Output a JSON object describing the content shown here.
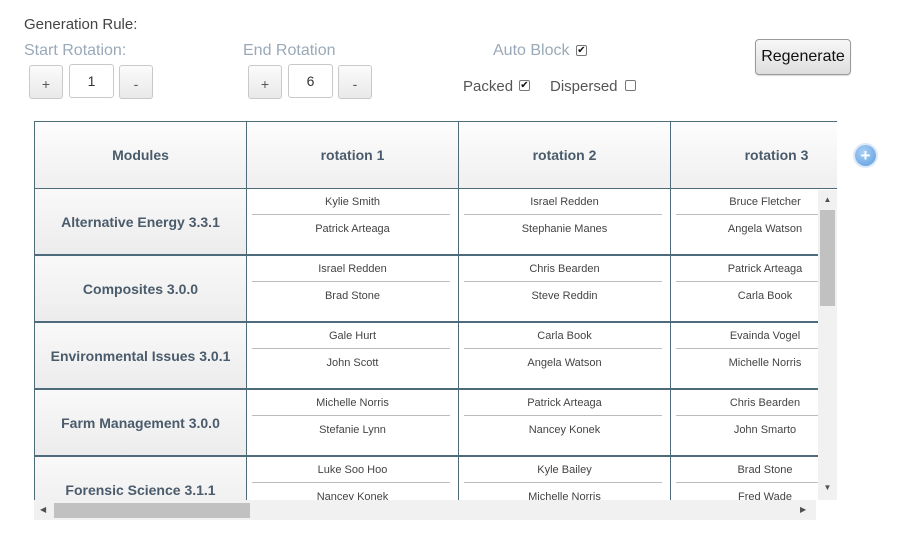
{
  "generation_rule_label": "Generation Rule:",
  "start_rotation": {
    "label": "Start Rotation:",
    "plus": "+",
    "minus": "-",
    "value": "1"
  },
  "end_rotation": {
    "label": "End Rotation",
    "plus": "+",
    "minus": "-",
    "value": "6"
  },
  "options": {
    "auto_block": {
      "label": "Auto Block",
      "checked": true
    },
    "packed": {
      "label": "Packed",
      "checked": true
    },
    "dispersed": {
      "label": "Dispersed",
      "checked": false
    }
  },
  "regenerate_label": "Regenerate",
  "check_glyph": "✔",
  "table": {
    "header": [
      "Modules",
      "rotation 1",
      "rotation 2",
      "rotation 3"
    ],
    "rows": [
      {
        "module": "Alternative Energy 3.3.1",
        "cells": [
          [
            "Kylie Smith",
            "Patrick Arteaga"
          ],
          [
            "Israel Redden",
            "Stephanie Manes"
          ],
          [
            "Bruce Fletcher",
            "Angela Watson"
          ]
        ]
      },
      {
        "module": "Composites 3.0.0",
        "cells": [
          [
            "Israel Redden",
            "Brad Stone"
          ],
          [
            "Chris Bearden",
            "Steve Reddin"
          ],
          [
            "Patrick Arteaga",
            "Carla Book"
          ]
        ]
      },
      {
        "module": "Environmental Issues 3.0.1",
        "cells": [
          [
            "Gale Hurt",
            "John Scott"
          ],
          [
            "Carla Book",
            "Angela Watson"
          ],
          [
            "Evainda Vogel",
            "Michelle Norris"
          ]
        ]
      },
      {
        "module": "Farm Management 3.0.0",
        "cells": [
          [
            "Michelle Norris",
            "Stefanie Lynn"
          ],
          [
            "Patrick Arteaga",
            "Nancey Konek"
          ],
          [
            "Chris Bearden",
            "John Smarto"
          ]
        ]
      },
      {
        "module": "Forensic Science 3.1.1",
        "cells": [
          [
            "Luke Soo Hoo",
            "Nancey Konek"
          ],
          [
            "Kyle Bailey",
            "Michelle Norris"
          ],
          [
            "Brad Stone",
            "Fred Wade"
          ]
        ]
      }
    ]
  },
  "icons": {
    "add_column": "plus-circle-icon",
    "scroll_up": "▲",
    "scroll_down": "▼",
    "scroll_left": "◀",
    "scroll_right": "▶",
    "add_glyph": "+"
  },
  "colors": {
    "border": "#4e6b7c",
    "header_text": "#4a5b6b",
    "muted_label": "#9aa9b8",
    "accent_add": "#5b9be0"
  }
}
